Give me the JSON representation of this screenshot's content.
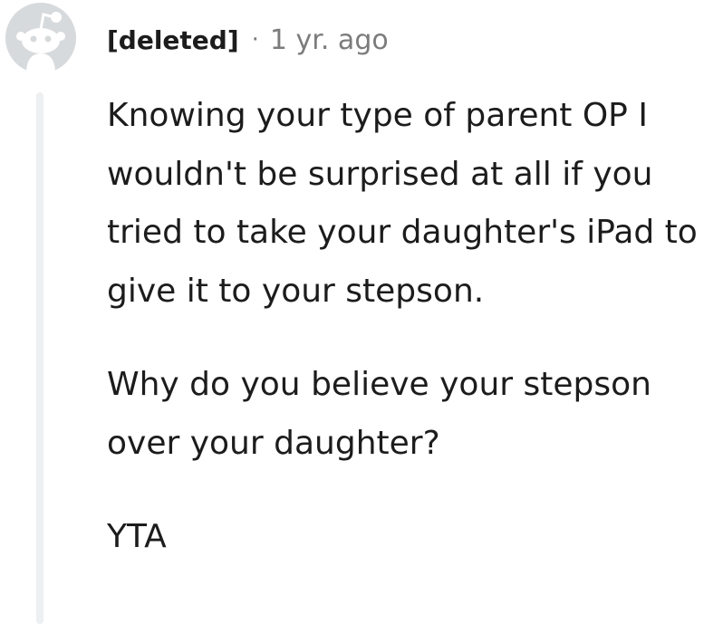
{
  "comment": {
    "author": "[deleted]",
    "separator": "·",
    "timestamp": "1 yr. ago",
    "avatar_icon": "snoo-avatar-icon",
    "paragraphs": [
      "Knowing your type of parent OP I wouldn't be surprised at all if you tried to take your daughter's iPad to give it to your stepson.",
      "Why do you believe your stepson over your daughter?",
      "YTA"
    ]
  },
  "colors": {
    "avatar_bg": "#d7dadc",
    "text": "#1c1c1c",
    "meta": "#7c7c7c",
    "thread_line": "#edeff1"
  }
}
